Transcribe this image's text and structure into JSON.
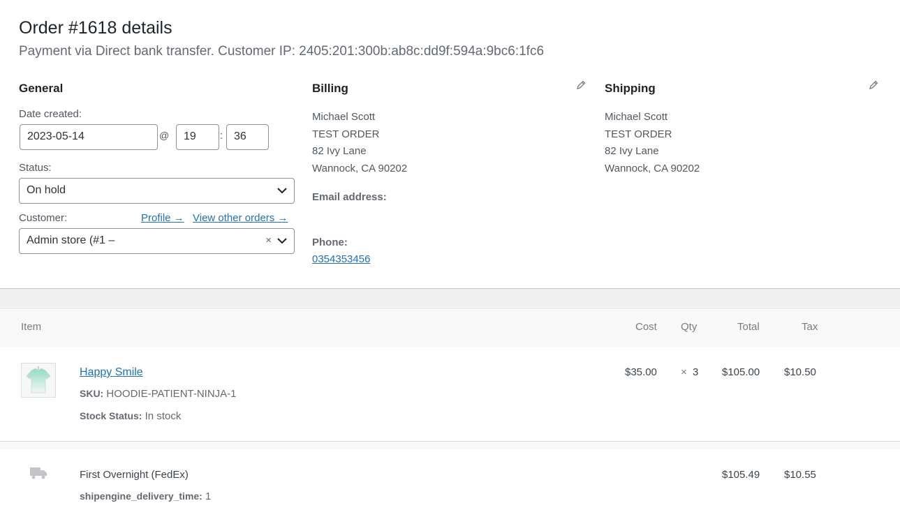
{
  "header": {
    "title": "Order #1618 details",
    "subtitle": "Payment via Direct bank transfer. Customer IP: 2405:201:300b:ab8c:dd9f:594a:9bc6:1fc6"
  },
  "general": {
    "heading": "General",
    "date_label": "Date created:",
    "date_value": "2023-05-14",
    "at_symbol": "@",
    "hour_value": "19",
    "time_separator": ":",
    "minute_value": "36",
    "status_label": "Status:",
    "status_value": "On hold",
    "customer_label": "Customer:",
    "profile_link": "Profile →",
    "other_orders_link": "View other orders →",
    "customer_value": "Admin store (#1 –",
    "clear_symbol": "×"
  },
  "billing": {
    "heading": "Billing",
    "address_lines": [
      "Michael Scott",
      "TEST ORDER",
      "82 Ivy Lane",
      "Wannock, CA 90202"
    ],
    "email_label": "Email address:",
    "phone_label": "Phone:",
    "phone_value": "0354353456"
  },
  "shipping": {
    "heading": "Shipping",
    "address_lines": [
      "Michael Scott",
      "TEST ORDER",
      "82 Ivy Lane",
      "Wannock, CA 90202"
    ]
  },
  "items_table": {
    "columns": {
      "item": "Item",
      "cost": "Cost",
      "qty": "Qty",
      "total": "Total",
      "tax": "Tax"
    },
    "product": {
      "name": "Happy Smile",
      "sku_label": "SKU:",
      "sku_value": "HOODIE-PATIENT-NINJA-1",
      "stock_label": "Stock Status:",
      "stock_value": "In stock",
      "cost": "$35.00",
      "qty_symbol": "×",
      "qty": "3",
      "total": "$105.00",
      "tax": "$10.50",
      "thumbnail_icon": "shirt-thumbnail"
    },
    "shipping_line": {
      "icon": "truck-icon",
      "name": "First Overnight (FedEx)",
      "meta_label": "shipengine_delivery_time:",
      "meta_value": "1",
      "total": "$105.49",
      "tax": "$10.55"
    }
  },
  "colors": {
    "link": "#2271b1",
    "heading": "#1d2327",
    "text": "#50575e",
    "border": "#8c8f94",
    "band": "#f0f0f1"
  }
}
